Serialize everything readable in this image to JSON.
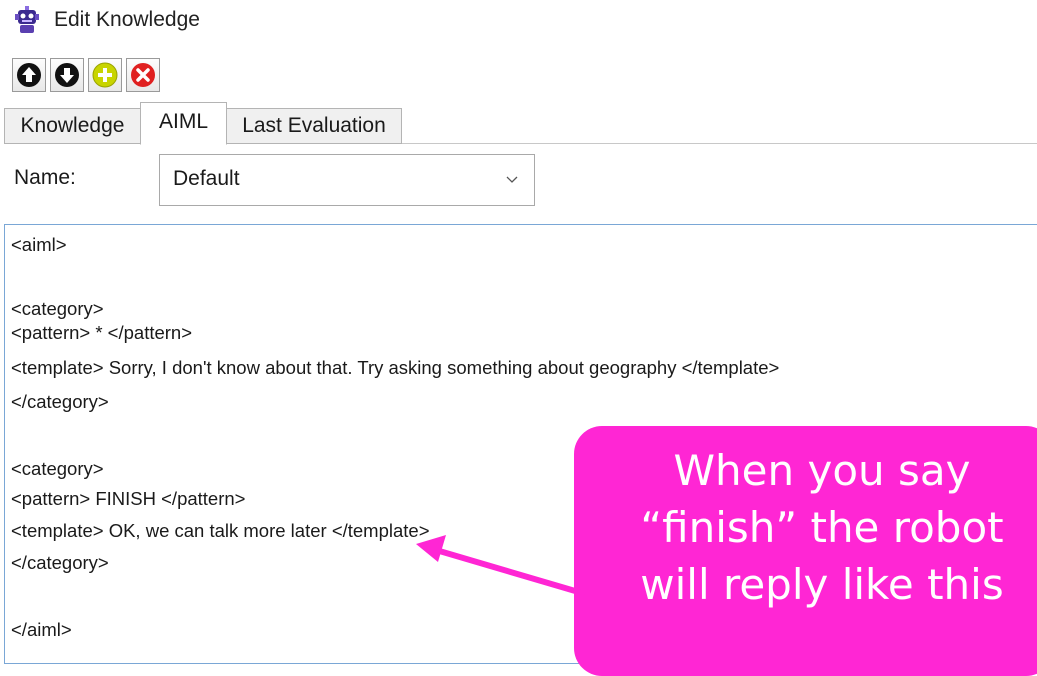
{
  "window": {
    "title": "Edit Knowledge",
    "icon": "robot-app-icon"
  },
  "toolbar": {
    "buttons": [
      {
        "icon": "arrow-up-circle-icon",
        "color": "#111111"
      },
      {
        "icon": "arrow-down-circle-icon",
        "color": "#111111"
      },
      {
        "icon": "add-circle-icon",
        "color": "#c8d400"
      },
      {
        "icon": "delete-circle-icon",
        "color": "#e02020"
      }
    ]
  },
  "tabs": [
    {
      "label": "Knowledge",
      "active": false
    },
    {
      "label": "AIML",
      "active": true
    },
    {
      "label": "Last Evaluation",
      "active": false
    }
  ],
  "name_field": {
    "label": "Name:",
    "selected": "Default"
  },
  "editor": {
    "lines": [
      "<aiml>",
      "",
      "<category>",
      "<pattern> * </pattern>",
      "<template> Sorry, I don't know about that. Try asking something about geography </template>",
      "</category>",
      "",
      "<category>",
      "<pattern> FINISH </pattern>",
      "<template> OK, we can talk more later </template>",
      "</category>",
      "",
      "</aiml>"
    ]
  },
  "callout": {
    "text": "When you say\n“finish” the robot\nwill reply like this",
    "color": "#ff26d4"
  }
}
